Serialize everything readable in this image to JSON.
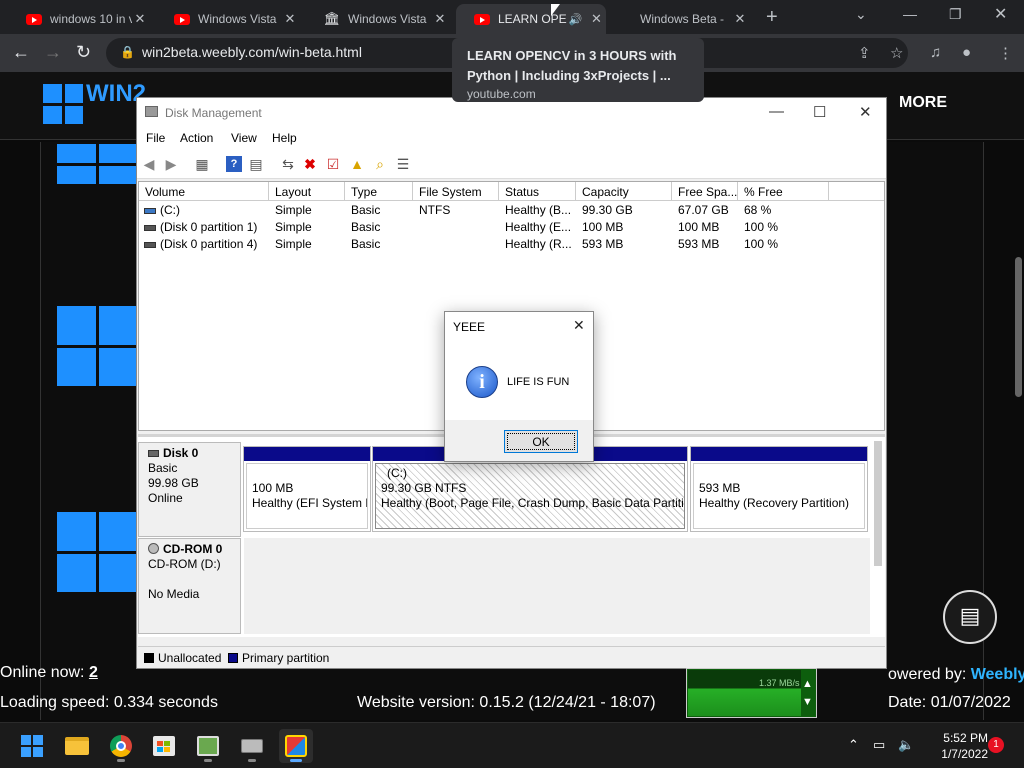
{
  "browser": {
    "tabs": [
      {
        "title": "windows 10 in v",
        "favicon": "youtube-icon"
      },
      {
        "title": "Windows Vista",
        "favicon": "youtube-icon"
      },
      {
        "title": "Windows Vista",
        "favicon": "museum-icon"
      },
      {
        "title": "LEARN OPE",
        "favicon": "youtube-icon",
        "audio": "speaker-icon"
      },
      {
        "title": "Windows Beta -",
        "favicon": "none"
      }
    ],
    "url": "win2beta.weebly.com/win-beta.html",
    "hovercard": {
      "title": "LEARN OPENCV in 3 HOURS with Python | Including 3xProjects | ...",
      "domain": "youtube.com"
    }
  },
  "site": {
    "brand": "WIN2",
    "nav_more": "MORE",
    "online_label": "Online now: ",
    "online_count": "2",
    "loading": "Loading speed: 0.334 seconds",
    "version": "Website version: 0.15.2 (12/24/21 - 18:07)",
    "powered_prefix": "owered by: ",
    "powered_brand": "Weebly",
    "date": "Date: 01/07/2022"
  },
  "disk_management": {
    "title": "Disk Management",
    "menu": [
      "File",
      "Action",
      "View",
      "Help"
    ],
    "columns": [
      "Volume",
      "Layout",
      "Type",
      "File System",
      "Status",
      "Capacity",
      "Free Spa...",
      "% Free"
    ],
    "volumes": [
      {
        "volume": "(C:)",
        "layout": "Simple",
        "type": "Basic",
        "fs": "NTFS",
        "status": "Healthy (B...",
        "capacity": "99.30 GB",
        "free": "67.07 GB",
        "pct": "68 %"
      },
      {
        "volume": "(Disk 0 partition 1)",
        "layout": "Simple",
        "type": "Basic",
        "fs": "",
        "status": "Healthy (E...",
        "capacity": "100 MB",
        "free": "100 MB",
        "pct": "100 %"
      },
      {
        "volume": "(Disk 0 partition 4)",
        "layout": "Simple",
        "type": "Basic",
        "fs": "",
        "status": "Healthy (R...",
        "capacity": "593 MB",
        "free": "593 MB",
        "pct": "100 %"
      }
    ],
    "disk0": {
      "name": "Disk 0",
      "type": "Basic",
      "size": "99.98 GB",
      "state": "Online",
      "partitions": [
        {
          "line1": "100 MB",
          "line2": "Healthy (EFI System P",
          "line0": ""
        },
        {
          "line0": "(C:)",
          "line1": "99.30 GB NTFS",
          "line2": "Healthy (Boot, Page File, Crash Dump, Basic Data Partition)"
        },
        {
          "line1": "593 MB",
          "line2": "Healthy (Recovery Partition)",
          "line0": ""
        }
      ]
    },
    "cdrom": {
      "name": "CD-ROM 0",
      "drive": "CD-ROM (D:)",
      "media": "No Media"
    },
    "legend": {
      "unallocated": "Unallocated",
      "primary": "Primary partition"
    }
  },
  "msgbox": {
    "title": "YEEE",
    "message": "LIFE IS FUN",
    "ok": "OK"
  },
  "netmon": {
    "rate": "1.37 MB/s"
  },
  "taskbar": {
    "apps": [
      "start-icon",
      "file-explorer-icon",
      "chrome-icon",
      "store-icon",
      "app-installer-icon",
      "disk-management-icon",
      "python-app-icon"
    ],
    "time": "5:52 PM",
    "date": "1/7/2022",
    "notifications": "1"
  }
}
